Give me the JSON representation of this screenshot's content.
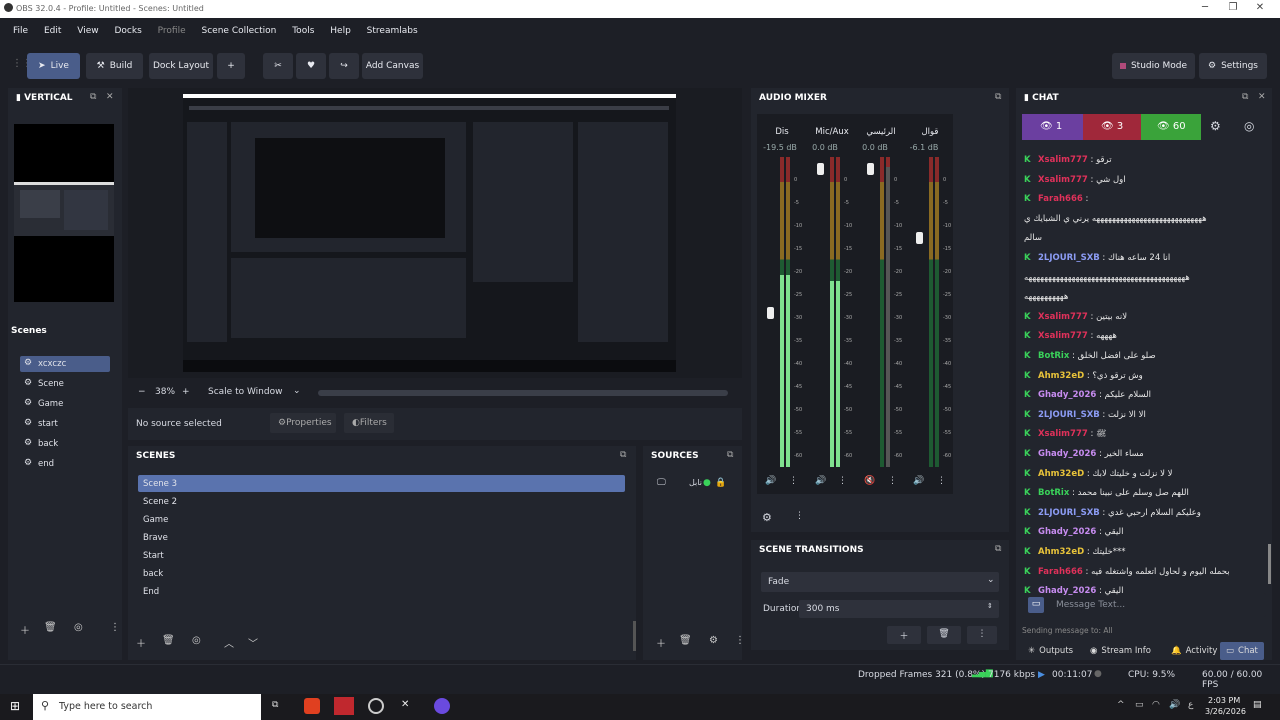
{
  "window": {
    "title": "OBS 32.0.4 - Profile: Untitled - Scenes: Untitled"
  },
  "menu": [
    "File",
    "Edit",
    "View",
    "Docks",
    "Profile",
    "Scene Collection",
    "Tools",
    "Help",
    "Streamlabs"
  ],
  "toolbar": {
    "live": "Live",
    "build": "Build",
    "dock_layout": "Dock Layout",
    "add": "+",
    "add_canvas": "Add Canvas",
    "studio_mode": "Studio Mode",
    "settings": "Settings"
  },
  "vertical": {
    "title": "VERTICAL",
    "scenes_title": "Scenes",
    "scenes": [
      "xcxczc",
      "Scene",
      "Game",
      "start",
      "back",
      "end"
    ]
  },
  "preview": {
    "zoom": "38%",
    "scale": "Scale to Window",
    "no_source": "No source selected",
    "properties": "Properties",
    "filters": "Filters"
  },
  "scenes": {
    "title": "SCENES",
    "items": [
      "Scene 3",
      "Scene 2",
      "Game",
      "Brave",
      "Start",
      "back",
      "End"
    ]
  },
  "sources": {
    "title": "SOURCES",
    "item": "نابل"
  },
  "audio": {
    "title": "AUDIO MIXER",
    "channels": [
      {
        "name": "Dis",
        "db": "-19.5 dB",
        "level": 0.62,
        "fader": 0.5
      },
      {
        "name": "Mic/Aux",
        "db": "0.0 dB",
        "level": 0.6,
        "fader": 0.98
      },
      {
        "name": "الرئيسي",
        "db": "0.0 dB",
        "level": 0.0,
        "fader": 0.98,
        "muted": true
      },
      {
        "name": "قوال",
        "db": "-6.1 dB",
        "level": 0.0,
        "fader": 0.75
      }
    ],
    "scale": [
      "0",
      "-5",
      "-10",
      "-15",
      "-20",
      "-25",
      "-30",
      "-35",
      "-40",
      "-45",
      "-50",
      "-55",
      "-60"
    ]
  },
  "transitions": {
    "title": "SCENE TRANSITIONS",
    "type": "Fade",
    "duration_label": "Duration",
    "duration": "300 ms"
  },
  "chat": {
    "title": "CHAT",
    "viewers": [
      {
        "n": "1",
        "c": "#6b3fa0"
      },
      {
        "n": "3",
        "c": "#a0283a"
      },
      {
        "n": "60",
        "c": "#3aa33a"
      }
    ],
    "lines": [
      {
        "u": "Xsalim777",
        "c": "#e0315a",
        "m": "ترقو"
      },
      {
        "u": "Xsalim777",
        "c": "#e0315a",
        "m": "اول شي"
      },
      {
        "u": "Farah666",
        "c": "#e0315a",
        "m": ""
      },
      {
        "u": "",
        "c": "#fff",
        "m": "ههههههههههههههههههههههههههههه يرني ي الشبايك ي"
      },
      {
        "u": "",
        "c": "#fff",
        "m": "سالم"
      },
      {
        "u": "2LJOURI_SXB",
        "c": "#8c9cf4",
        "m": "انا 24 ساعه هناك"
      },
      {
        "u": "",
        "c": "#fff",
        "m": "هههههههههههههههههههههههههههههههههههههههههه"
      },
      {
        "u": "",
        "c": "#fff",
        "m": "ههههههههههه"
      },
      {
        "u": "Xsalim777",
        "c": "#e0315a",
        "m": "لانه بيتين"
      },
      {
        "u": "Xsalim777",
        "c": "#e0315a",
        "m": "ههههه"
      },
      {
        "u": "BotRix",
        "c": "#3ad25a",
        "m": "صلو على افضل الخلق"
      },
      {
        "u": "Ahm32eD",
        "c": "#e8c33a",
        "m": "وش ترقو ذي؟"
      },
      {
        "u": "Ghady_2026",
        "c": "#c78cf0",
        "m": "السلام عليكم"
      },
      {
        "u": "2LJOURI_SXB",
        "c": "#8c9cf4",
        "m": "الا الا نزلت"
      },
      {
        "u": "Xsalim777",
        "c": "#e0315a",
        "m": "ﷺ"
      },
      {
        "u": "Ghady_2026",
        "c": "#c78cf0",
        "m": "مساء الخير"
      },
      {
        "u": "Ahm32eD",
        "c": "#e8c33a",
        "m": "لا لا نزلت و خليتك لابك"
      },
      {
        "u": "BotRix",
        "c": "#3ad25a",
        "m": "اللهم صل وسلم على نبينا محمد"
      },
      {
        "u": "2LJOURI_SXB",
        "c": "#8c9cf4",
        "m": "وعليكم السلام ارحبي غدي"
      },
      {
        "u": "Ghady_2026",
        "c": "#c78cf0",
        "m": "اليقي"
      },
      {
        "u": "Ahm32eD",
        "c": "#e8c33a",
        "m": "خليتك***"
      },
      {
        "u": "Farah666",
        "c": "#e0315a",
        "m": "بحمله اليوم و لحاول اتعلمه واشتغله فيه"
      },
      {
        "u": "Ghady_2026",
        "c": "#c78cf0",
        "m": "اليقي"
      }
    ],
    "placeholder": "Message Text...",
    "sending": "Sending message to: All",
    "tabs": [
      "Outputs",
      "Stream Info",
      "Activity",
      "Chat"
    ]
  },
  "status": {
    "dropped": "Dropped Frames 321 (0.8%)",
    "kbps": "7176 kbps",
    "time": "00:11:07",
    "cpu": "CPU: 9.5%",
    "fps": "60.00 / 60.00 FPS"
  },
  "taskbar": {
    "search": "Type here to search",
    "clock": "2:03 PM",
    "date": "3/26/2026",
    "lang": "ع"
  }
}
